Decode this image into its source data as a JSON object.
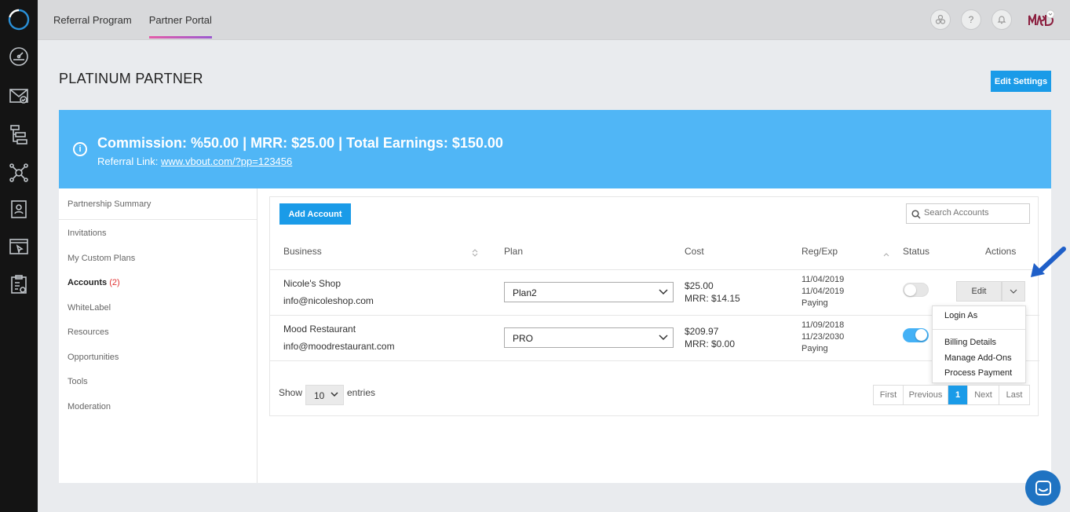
{
  "topnav": {
    "tabs": [
      "Referral Program",
      "Partner Portal"
    ],
    "active_tab": "Partner Portal"
  },
  "header": {
    "title": "PLATINUM PARTNER",
    "edit_settings_label": "Edit Settings",
    "help_label": "?"
  },
  "banner": {
    "info_glyph": "i",
    "headline": "Commission: %50.00 | MRR: $25.00 | Total Earnings: $150.00",
    "referral_prefix": "Referral Link:",
    "referral_link": "www.vbout.com/?pp=123456"
  },
  "leftnav": {
    "summary": "Partnership Summary",
    "items": [
      "Invitations",
      "My Custom Plans",
      "Accounts",
      "WhiteLabel",
      "Resources",
      "Opportunities",
      "Tools",
      "Moderation"
    ],
    "accounts_count": "(2)",
    "active": "Accounts"
  },
  "accounts": {
    "add_label": "Add Account",
    "search_placeholder": "Search Accounts",
    "columns": [
      "Business",
      "Plan",
      "Cost",
      "Reg/Exp",
      "Status",
      "Actions"
    ],
    "rows": [
      {
        "business": "Nicole's Shop",
        "email": "info@nicoleshop.com",
        "plan": "Plan2",
        "cost": "$25.00",
        "mrr": "MRR: $14.15",
        "reg": "11/04/2019",
        "exp": "11/04/2019",
        "state": "Paying",
        "status_on": false
      },
      {
        "business": "Mood Restaurant",
        "email": "info@moodrestaurant.com",
        "plan": "PRO",
        "cost": "$209.97",
        "mrr": "MRR: $0.00",
        "reg": "11/09/2018",
        "exp": "11/23/2030",
        "state": "Paying",
        "status_on": true
      }
    ],
    "edit_label": "Edit",
    "dropdown": [
      "Login As",
      "Billing Details",
      "Manage Add-Ons",
      "Process Payment"
    ],
    "show_label": "Show",
    "page_size": "10",
    "entries_label": "entries",
    "pagination": [
      "First",
      "Previous",
      "1",
      "Next",
      "Last"
    ],
    "current_page": "1"
  },
  "colors": {
    "accent": "#1a9be8",
    "banner": "#50b6f6",
    "sidebar": "#141414",
    "alert": "#e03131"
  }
}
